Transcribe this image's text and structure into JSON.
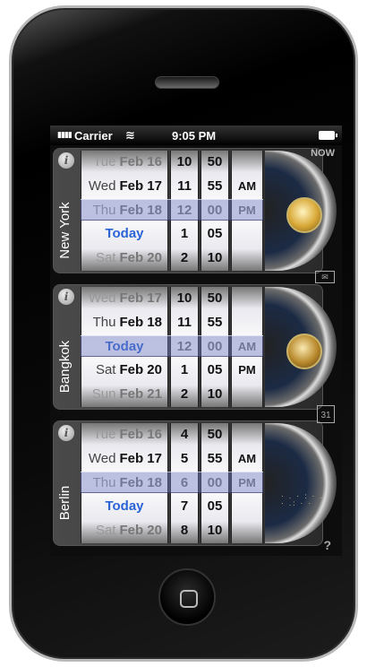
{
  "status": {
    "signal": "▮▮▮▮",
    "carrier": "Carrier",
    "wifi": "≋",
    "time": "9:05 PM"
  },
  "side": {
    "now_label": "NOW",
    "mail_icon": "✉",
    "calendar_day": "31",
    "help": "?"
  },
  "clocks": [
    {
      "city": "New York",
      "dates": [
        {
          "dow": "Tue",
          "date": "Feb 16"
        },
        {
          "dow": "Wed",
          "date": "Feb 17"
        },
        {
          "dow": "Thu",
          "date": "Feb 18"
        },
        {
          "dow": "",
          "date": "Today"
        },
        {
          "dow": "Sat",
          "date": "Feb 20"
        }
      ],
      "hours": [
        "10",
        "11",
        "12",
        "1",
        "2"
      ],
      "minutes": [
        "50",
        "55",
        "00",
        "05",
        "10"
      ],
      "ampm": [
        "",
        "AM",
        "PM",
        "",
        ""
      ]
    },
    {
      "city": "Bangkok",
      "dates": [
        {
          "dow": "Wed",
          "date": "Feb 17"
        },
        {
          "dow": "Thu",
          "date": "Feb 18"
        },
        {
          "dow": "",
          "date": "Today"
        },
        {
          "dow": "Sat",
          "date": "Feb 20"
        },
        {
          "dow": "Sun",
          "date": "Feb 21"
        }
      ],
      "hours": [
        "10",
        "11",
        "12",
        "1",
        "2"
      ],
      "minutes": [
        "50",
        "55",
        "00",
        "05",
        "10"
      ],
      "ampm": [
        "",
        "",
        "AM",
        "PM",
        ""
      ]
    },
    {
      "city": "Berlin",
      "dates": [
        {
          "dow": "Tue",
          "date": "Feb 16"
        },
        {
          "dow": "Wed",
          "date": "Feb 17"
        },
        {
          "dow": "Thu",
          "date": "Feb 18"
        },
        {
          "dow": "",
          "date": "Today"
        },
        {
          "dow": "Sat",
          "date": "Feb 20"
        }
      ],
      "hours": [
        "4",
        "5",
        "6",
        "7",
        "8"
      ],
      "minutes": [
        "50",
        "55",
        "00",
        "05",
        "10"
      ],
      "ampm": [
        "",
        "AM",
        "PM",
        "",
        ""
      ]
    }
  ]
}
